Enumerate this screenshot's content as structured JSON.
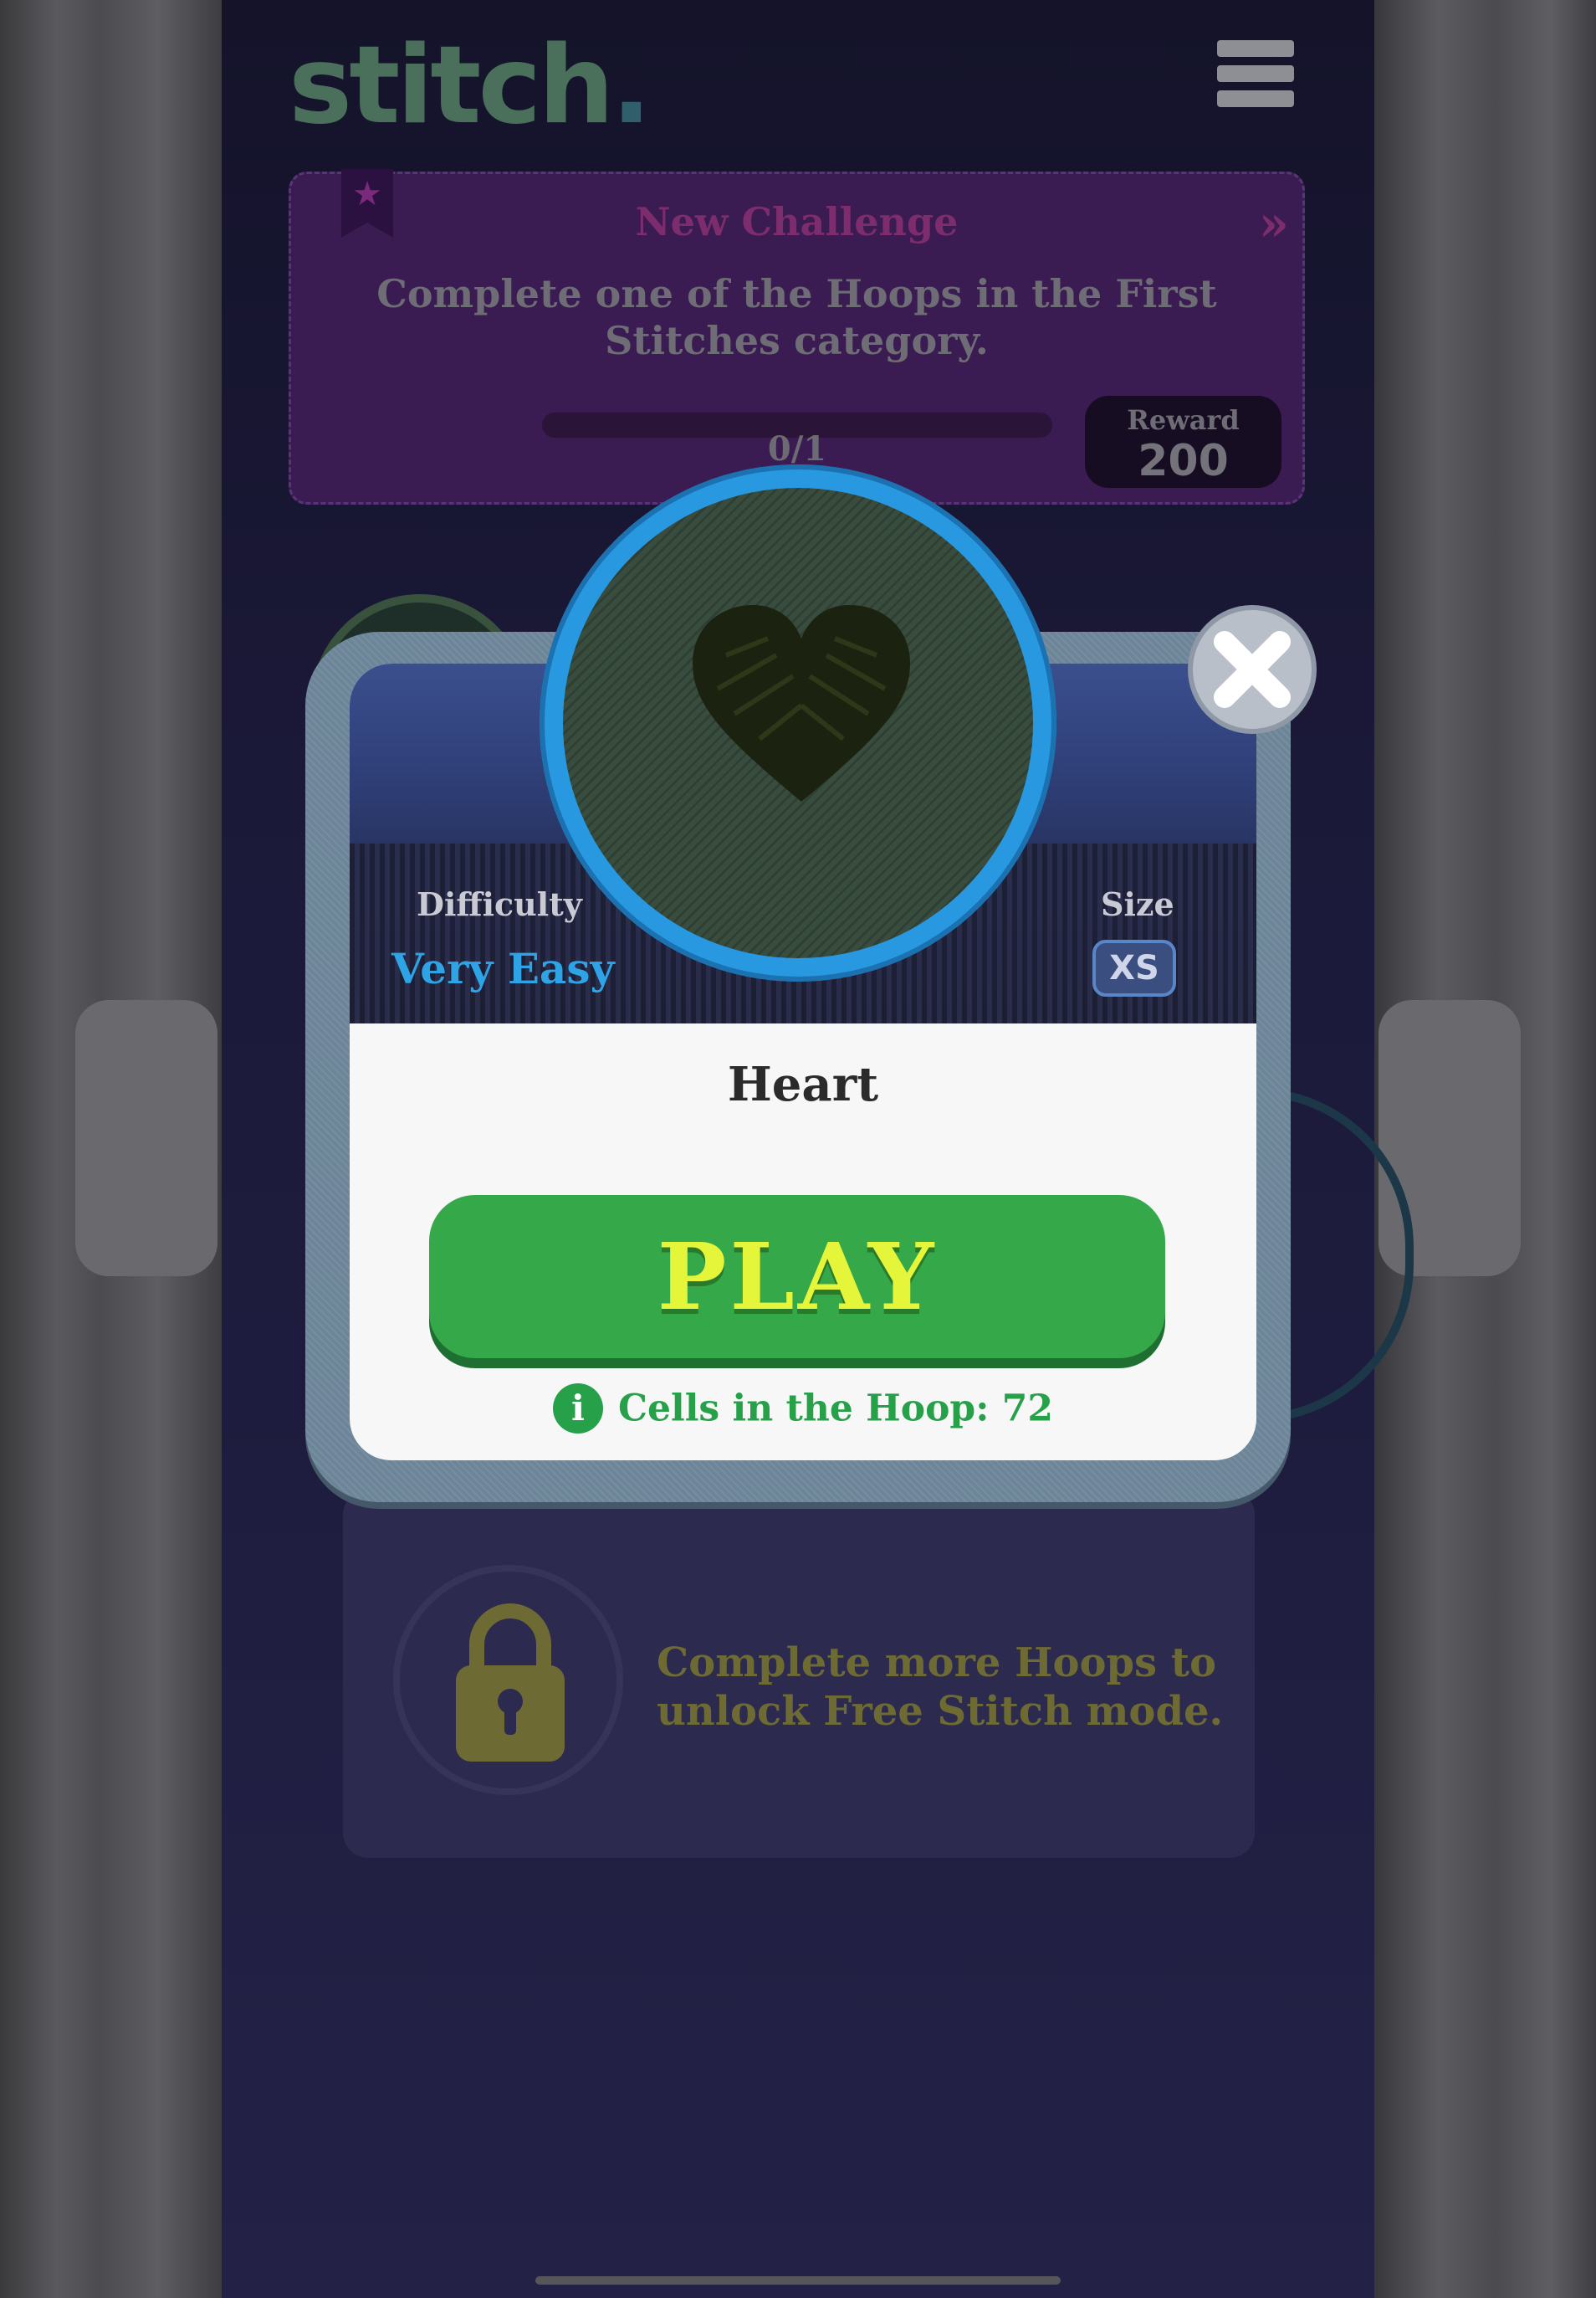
{
  "app": {
    "logo_text": "stitch",
    "logo_dot": "."
  },
  "challenge": {
    "title": "New Challenge",
    "arrows": "»",
    "description": "Complete one of the Hoops in the First Stitches category.",
    "progress_text": "0/1",
    "progress": 0,
    "reward_label": "Reward",
    "reward_value": "200"
  },
  "locked_card": {
    "text": "Complete more Hoops to unlock Free Stitch mode."
  },
  "modal": {
    "difficulty_label": "Difficulty",
    "difficulty_value": "Very Easy",
    "size_label": "Size",
    "size_value": "XS",
    "hoop_title": "Heart",
    "play_label": "PLAY",
    "info_icon": "i",
    "info_text": "Cells in the Hoop: 72"
  },
  "icons": {
    "menu": "hamburger-icon",
    "close": "close-icon",
    "info": "info-icon",
    "lock": "lock-icon",
    "heart": "heart-icon",
    "ribbon": "ribbon-star-icon"
  },
  "colors": {
    "play_button": "#35a84a",
    "play_text": "#e5f53a",
    "difficulty": "#2ea4e6",
    "info": "#27a04a",
    "hoop_ring": "#2898e0"
  }
}
